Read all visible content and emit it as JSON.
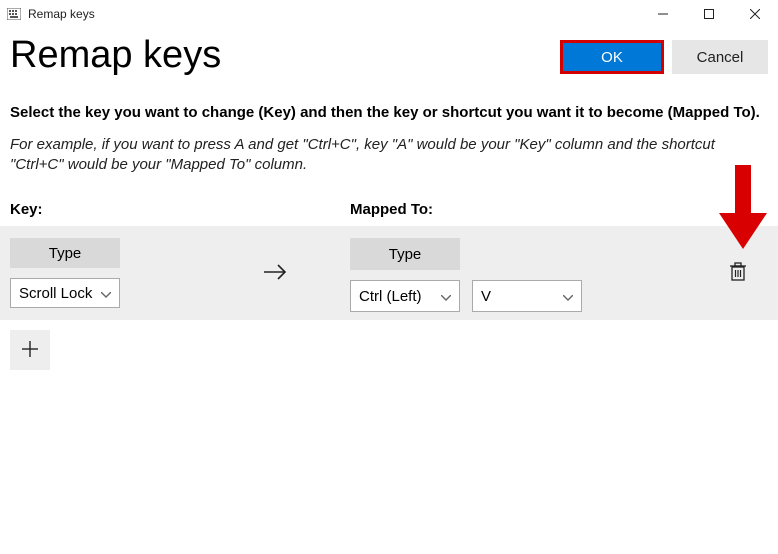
{
  "window": {
    "title": "Remap keys"
  },
  "header": {
    "page_title": "Remap keys",
    "ok_label": "OK",
    "cancel_label": "Cancel"
  },
  "instructions": {
    "bold": "Select the key you want to change (Key) and then the key or shortcut you want it to become (Mapped To).",
    "italic": "For example, if you want to press A and get \"Ctrl+C\", key \"A\" would be your \"Key\" column and the shortcut \"Ctrl+C\" would be your \"Mapped To\" column."
  },
  "columns": {
    "key_label": "Key:",
    "mapped_label": "Mapped To:"
  },
  "row": {
    "type_label": "Type",
    "key_value": "Scroll Lock",
    "mapped_modifier": "Ctrl (Left)",
    "mapped_key": "V"
  }
}
